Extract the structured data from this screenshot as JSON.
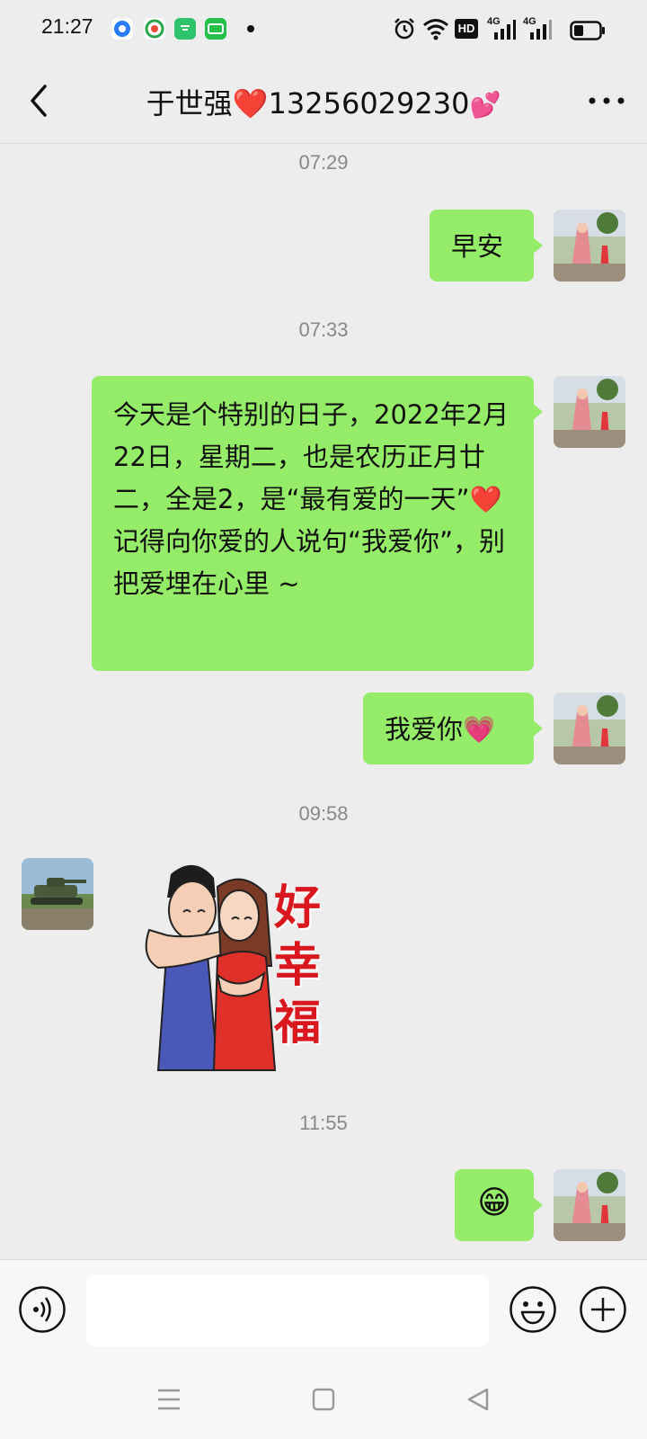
{
  "status_bar": {
    "time": "21:27",
    "icons_left": [
      "app-notification-icon",
      "browser-app-icon",
      "green-app-icon",
      "iqiyi-app-icon",
      "more-notifications-dot"
    ],
    "icons_right": [
      "alarm-icon",
      "wifi-icon",
      "hd-icon",
      "signal-4g-icon",
      "signal-4g-icon",
      "battery-icon"
    ],
    "hd_label": "HD",
    "net_label": "4G"
  },
  "header": {
    "title_name": "于世强",
    "title_heart": "❤️",
    "title_phone": "13256029230",
    "title_hearts": "💕",
    "back_icon": "chevron-left-icon",
    "more_icon": "more-dots-icon"
  },
  "messages": {
    "ts1": "07:29",
    "msg1": "早安",
    "ts2": "07:33",
    "msg2_part1": "今天是个特别的日子，2022年2月22日，星期二，也是农历正月廿二，全是2，是“最有爱的一天”",
    "msg2_heart": "❤️",
    "msg2_part2": "记得向你爱的人说句“我爱你”，别把爱埋在心里 ~",
    "msg3_text": "我爱你",
    "msg3_heart": "💗",
    "ts3": "09:58",
    "sticker_text": "好\n幸\n福",
    "ts4": "11:55",
    "msg5_emoji": "😁"
  },
  "input_bar": {
    "placeholder": "",
    "value": "",
    "voice_icon": "voice-icon",
    "emoji_icon": "emoji-icon",
    "plus_icon": "plus-icon"
  },
  "nav_bar": {
    "icons": [
      "menu-icon",
      "home-square-icon",
      "back-triangle-icon"
    ]
  },
  "colors": {
    "background": "#ededed",
    "my_bubble": "#95ec69",
    "timestamp": "#888888",
    "heart_red": "#e0202c",
    "sticker_text_red": "#d8171e"
  }
}
